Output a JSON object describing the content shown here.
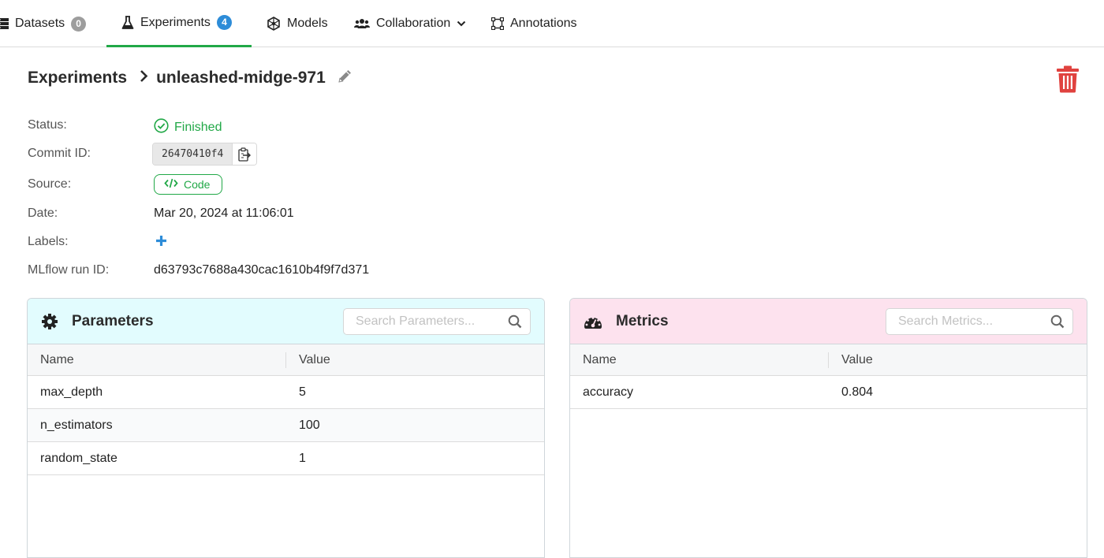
{
  "nav": {
    "tabs": [
      {
        "label": "Datasets",
        "badge": "0"
      },
      {
        "label": "Experiments",
        "badge": "4"
      },
      {
        "label": "Models"
      },
      {
        "label": "Collaboration"
      },
      {
        "label": "Annotations"
      }
    ],
    "active_tab": "Experiments"
  },
  "breadcrumb": {
    "parent": "Experiments",
    "current": "unleashed-midge-971"
  },
  "details": {
    "status_label": "Status:",
    "status_value": "Finished",
    "commit_label": "Commit ID:",
    "commit_value": "26470410f4",
    "source_label": "Source:",
    "source_button": "Code",
    "date_label": "Date:",
    "date_value": "Mar 20, 2024 at 11:06:01",
    "labels_label": "Labels:",
    "mlflow_label": "MLflow run ID:",
    "mlflow_value": "d63793c7688a430cac1610b4f9f7d371"
  },
  "parameters": {
    "title": "Parameters",
    "search_placeholder": "Search Parameters...",
    "columns": [
      "Name",
      "Value"
    ],
    "rows": [
      {
        "name": "max_depth",
        "value": "5"
      },
      {
        "name": "n_estimators",
        "value": "100"
      },
      {
        "name": "random_state",
        "value": "1"
      }
    ]
  },
  "metrics": {
    "title": "Metrics",
    "search_placeholder": "Search Metrics...",
    "columns": [
      "Name",
      "Value"
    ],
    "rows": [
      {
        "name": "accuracy",
        "value": "0.804"
      }
    ]
  },
  "colors": {
    "accent_green": "#21a847",
    "badge_blue": "#2d8cd8",
    "delete_red": "#e0423f",
    "params_header": "#e2fcfe",
    "metrics_header": "#fde2ee"
  },
  "icons": {
    "datasets": "server-stack-icon",
    "experiments": "flask-icon",
    "models": "cube-network-icon",
    "collaboration": "users-icon",
    "annotations": "bounding-box-icon",
    "breadcrumb_separator": "chevron-right-icon",
    "rename": "pencil-icon",
    "delete": "trash-icon",
    "status": "check-circle-icon",
    "copy": "clipboard-copy-icon",
    "source": "code-icon",
    "add_label": "plus-icon",
    "parameters": "gear-icon",
    "metrics": "gauge-icon",
    "search": "search-icon"
  }
}
